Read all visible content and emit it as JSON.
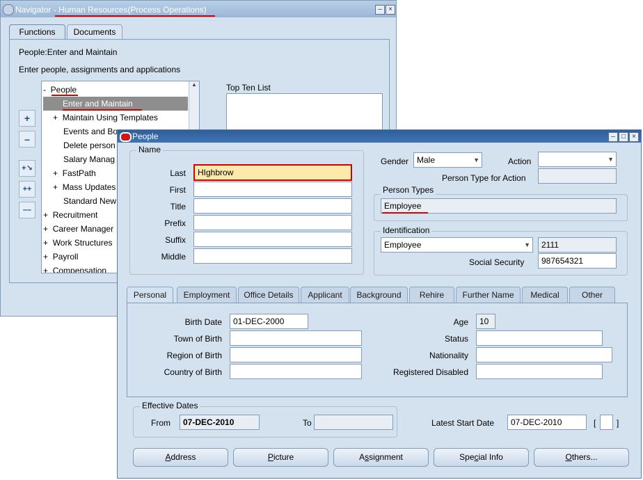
{
  "navigator": {
    "title": "Navigator - Human Resources(Process Operations)",
    "tabs": [
      "Functions",
      "Documents"
    ],
    "function_path": "People:Enter and Maintain",
    "instruction": "Enter people, assignments and applications",
    "top_ten_label": "Top Ten List",
    "tree": [
      {
        "prefix": "-",
        "label": "People"
      },
      {
        "prefix": "",
        "label": "Enter and Maintain"
      },
      {
        "prefix": "+",
        "label": "Maintain Using Templates"
      },
      {
        "prefix": "",
        "label": "Events and Bo"
      },
      {
        "prefix": "",
        "label": "Delete person"
      },
      {
        "prefix": "",
        "label": "Salary Manag"
      },
      {
        "prefix": "+",
        "label": "FastPath"
      },
      {
        "prefix": "+",
        "label": "Mass Updates"
      },
      {
        "prefix": "",
        "label": "Standard New"
      },
      {
        "prefix": "+",
        "label": "Recruitment"
      },
      {
        "prefix": "+",
        "label": "Career Manager"
      },
      {
        "prefix": "+",
        "label": "Work Structures"
      },
      {
        "prefix": "+",
        "label": "Payroll"
      },
      {
        "prefix": "+",
        "label": "Compensation"
      }
    ]
  },
  "people": {
    "title": "People",
    "name_group_label": "Name",
    "name_fields": [
      {
        "label": "Last",
        "value": "HIghbrow"
      },
      {
        "label": "First",
        "value": ""
      },
      {
        "label": "Title",
        "value": ""
      },
      {
        "label": "Prefix",
        "value": ""
      },
      {
        "label": "Suffix",
        "value": ""
      },
      {
        "label": "Middle",
        "value": ""
      }
    ],
    "gender_label": "Gender",
    "gender_value": "Male",
    "action_label": "Action",
    "action_value": "",
    "person_type_action_label": "Person Type for Action",
    "person_types_label": "Person Types",
    "person_types_value": "Employee",
    "identification_label": "Identification",
    "identification_type": "Employee",
    "identification_number": "2111",
    "social_security_label": "Social Security",
    "social_security_value": "987654321",
    "tabs": [
      "Personal",
      "Employment",
      "Office Details",
      "Applicant",
      "Background",
      "Rehire",
      "Further Name",
      "Medical",
      "Other"
    ],
    "personal": {
      "birth_date_label": "Birth Date",
      "birth_date_value": "01-DEC-2000",
      "town_label": "Town of Birth",
      "region_label": "Region of Birth",
      "country_label": "Country of Birth",
      "age_label": "Age",
      "age_value": "10",
      "status_label": "Status",
      "nationality_label": "Nationality",
      "disabled_label": "Registered Disabled"
    },
    "effective_dates_label": "Effective Dates",
    "from_label": "From",
    "from_value": "07-DEC-2010",
    "to_label": "To",
    "latest_start_label": "Latest Start Date",
    "latest_start_value": "07-DEC-2010",
    "bracket_left": "[",
    "bracket_right": "]",
    "buttons": [
      {
        "pre": "",
        "mnemonic": "A",
        "post": "ddress"
      },
      {
        "pre": "",
        "mnemonic": "P",
        "post": "icture"
      },
      {
        "pre": "A",
        "mnemonic": "s",
        "post": "signment"
      },
      {
        "pre": "Spe",
        "mnemonic": "c",
        "post": "ial Info"
      },
      {
        "pre": "",
        "mnemonic": "O",
        "post": "thers..."
      }
    ]
  },
  "colors": {
    "accent_red": "#d40000",
    "title_blue": "#2f5f9a",
    "highlight_field": "#fde9a9"
  }
}
